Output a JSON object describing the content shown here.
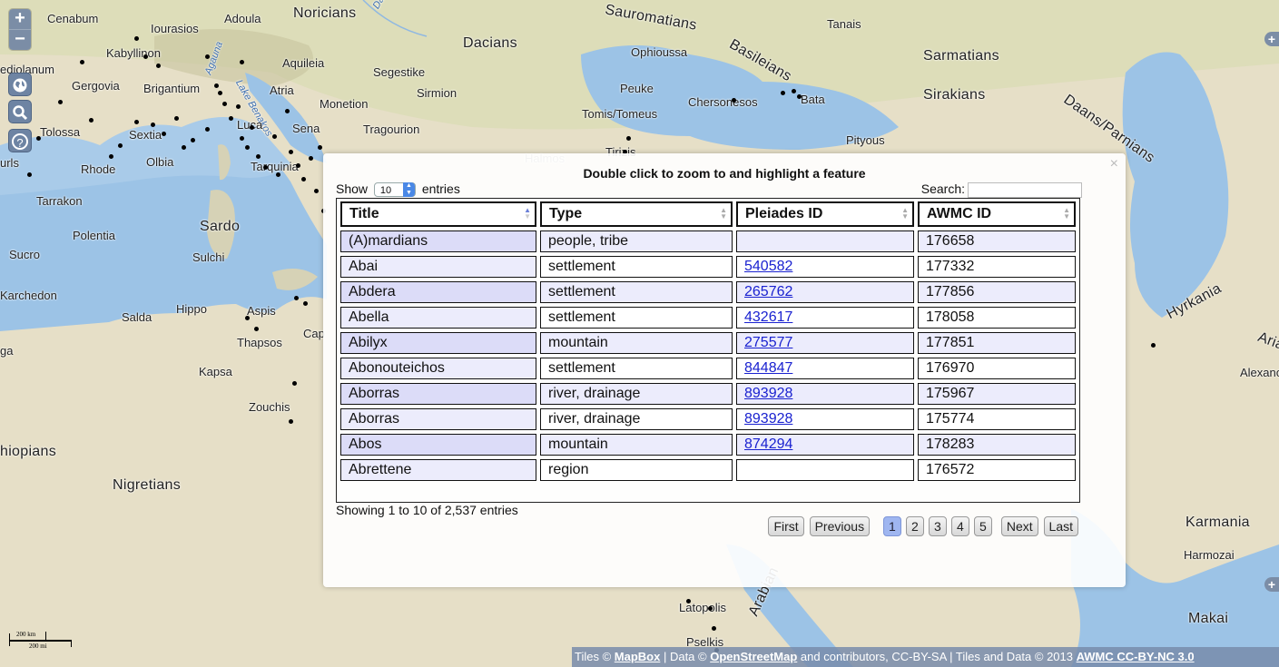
{
  "map": {
    "controls": {
      "zoom_in": "+",
      "zoom_out": "−",
      "help": "?"
    },
    "labels": [
      {
        "text": "Cenabum",
        "cls": "lbl-sm"
      },
      {
        "text": "Adoula",
        "cls": "lbl-sm"
      },
      {
        "text": "Noricians",
        "cls": "lbl-lg"
      },
      {
        "text": "Danuvius",
        "cls": "lbl-water"
      },
      {
        "text": "Iourasios",
        "cls": "lbl-sm"
      },
      {
        "text": "Sauromatians",
        "cls": "lbl-lg"
      },
      {
        "text": "Tanais",
        "cls": "lbl-sm"
      },
      {
        "text": "Kabyllinon",
        "cls": "lbl-sm"
      },
      {
        "text": "Dacians",
        "cls": "lbl-lg"
      },
      {
        "text": "Basileians",
        "cls": "lbl-lg"
      },
      {
        "text": "Ophioussa",
        "cls": "lbl-sm"
      },
      {
        "text": "Sarmatians",
        "cls": "lbl-lg"
      },
      {
        "text": "Aquileia",
        "cls": "lbl-sm"
      },
      {
        "text": "ediolanum",
        "cls": "lbl-sm"
      },
      {
        "text": "Segestike",
        "cls": "lbl-sm"
      },
      {
        "text": "Gergovia",
        "cls": "lbl-sm"
      },
      {
        "text": "Brigantium",
        "cls": "lbl-sm"
      },
      {
        "text": "Agauna",
        "cls": "lbl-water"
      },
      {
        "text": "Lake Benakos",
        "cls": "lbl-water"
      },
      {
        "text": "Atria",
        "cls": "lbl-sm"
      },
      {
        "text": "Sirmion",
        "cls": "lbl-sm"
      },
      {
        "text": "Peuke",
        "cls": "lbl-sm"
      },
      {
        "text": "Sirakians",
        "cls": "lbl-lg"
      },
      {
        "text": "Daans/Parnians",
        "cls": "lbl-lg"
      },
      {
        "text": "Monetion",
        "cls": "lbl-sm"
      },
      {
        "text": "Chersonesos",
        "cls": "lbl-sm"
      },
      {
        "text": "Bata",
        "cls": "lbl-sm"
      },
      {
        "text": "Tomis/Tomeus",
        "cls": "lbl-sm"
      },
      {
        "text": "Tolossa",
        "cls": "lbl-sm"
      },
      {
        "text": "Luca",
        "cls": "lbl-sm"
      },
      {
        "text": "Sena",
        "cls": "lbl-sm"
      },
      {
        "text": "Tragourion",
        "cls": "lbl-sm"
      },
      {
        "text": "Sextia",
        "cls": "lbl-sm"
      },
      {
        "text": "Pityous",
        "cls": "lbl-sm"
      },
      {
        "text": "urls",
        "cls": "lbl-sm"
      },
      {
        "text": "Olbia",
        "cls": "lbl-sm"
      },
      {
        "text": "Tarquinia",
        "cls": "lbl-sm"
      },
      {
        "text": "Halmos",
        "cls": "lbl-sm lbl-faint"
      },
      {
        "text": "Tirizis",
        "cls": "lbl-sm"
      },
      {
        "text": "Rhode",
        "cls": "lbl-sm"
      },
      {
        "text": "Tarrakon",
        "cls": "lbl-sm"
      },
      {
        "text": "Sardo",
        "cls": "lbl-lg"
      },
      {
        "text": "Polentia",
        "cls": "lbl-sm"
      },
      {
        "text": "Sucro",
        "cls": "lbl-sm"
      },
      {
        "text": "Sulchi",
        "cls": "lbl-sm"
      },
      {
        "text": "Karchedon",
        "cls": "lbl-sm"
      },
      {
        "text": "Hippo",
        "cls": "lbl-sm"
      },
      {
        "text": "Aspis",
        "cls": "lbl-sm"
      },
      {
        "text": "Salda",
        "cls": "lbl-sm"
      },
      {
        "text": "Thapsos",
        "cls": "lbl-sm"
      },
      {
        "text": "Cap",
        "cls": "lbl-sm"
      },
      {
        "text": "ga",
        "cls": "lbl-sm"
      },
      {
        "text": "Kapsa",
        "cls": "lbl-sm"
      },
      {
        "text": "Zouchis",
        "cls": "lbl-sm"
      },
      {
        "text": "hiopians",
        "cls": "lbl-lg"
      },
      {
        "text": "Nigretians",
        "cls": "lbl-lg"
      },
      {
        "text": "Hyrkania",
        "cls": "lbl-lg"
      },
      {
        "text": "Aria",
        "cls": "lbl-lg"
      },
      {
        "text": "Alexano",
        "cls": "lbl-sm"
      },
      {
        "text": "Karmania",
        "cls": "lbl-lg"
      },
      {
        "text": "Harmozai",
        "cls": "lbl-sm"
      },
      {
        "text": "Latopolis",
        "cls": "lbl-sm"
      },
      {
        "text": "Pselkis",
        "cls": "lbl-sm"
      },
      {
        "text": "Makai",
        "cls": "lbl-lg"
      },
      {
        "text": "Arabian",
        "cls": "lbl-lg"
      }
    ],
    "scale": {
      "km": "200 km",
      "mi": "200 mi"
    },
    "attribution": {
      "prefix": "Tiles © ",
      "mapbox": "MapBox",
      "mid1": " | Data © ",
      "osm": "OpenStreetMap",
      "mid2": " and contributors, CC-BY-SA | Tiles and Data © 2013 ",
      "awmc": "AWMC CC-BY-NC 3.0"
    }
  },
  "modal": {
    "close": "×",
    "heading": "Double click to zoom to and highlight a feature",
    "show_label": "Show",
    "entries_label": "entries",
    "page_length": "10",
    "search_label": "Search:",
    "search_value": "",
    "columns": [
      "Title",
      "Type",
      "Pleiades ID",
      "AWMC ID"
    ],
    "rows": [
      {
        "title": "(A)mardians",
        "type": "people, tribe",
        "pleiades": "",
        "awmc": "176658"
      },
      {
        "title": "Abai",
        "type": "settlement",
        "pleiades": "540582",
        "awmc": "177332"
      },
      {
        "title": "Abdera",
        "type": "settlement",
        "pleiades": "265762",
        "awmc": "177856"
      },
      {
        "title": "Abella",
        "type": "settlement",
        "pleiades": "432617",
        "awmc": "178058"
      },
      {
        "title": "Abilyx",
        "type": "mountain",
        "pleiades": "275577",
        "awmc": "177851"
      },
      {
        "title": "Abonouteichos",
        "type": "settlement",
        "pleiades": "844847",
        "awmc": "176970"
      },
      {
        "title": "Aborras",
        "type": "river, drainage",
        "pleiades": "893928",
        "awmc": "175967"
      },
      {
        "title": "Aborras",
        "type": "river, drainage",
        "pleiades": "893928",
        "awmc": "175774"
      },
      {
        "title": "Abos",
        "type": "mountain",
        "pleiades": "874294",
        "awmc": "178283"
      },
      {
        "title": "Abrettene",
        "type": "region",
        "pleiades": "",
        "awmc": "176572"
      }
    ],
    "info": "Showing 1 to 10 of 2,537 entries",
    "pager": {
      "first": "First",
      "previous": "Previous",
      "pages": [
        "1",
        "2",
        "3",
        "4",
        "5"
      ],
      "current": "1",
      "next": "Next",
      "last": "Last"
    }
  }
}
